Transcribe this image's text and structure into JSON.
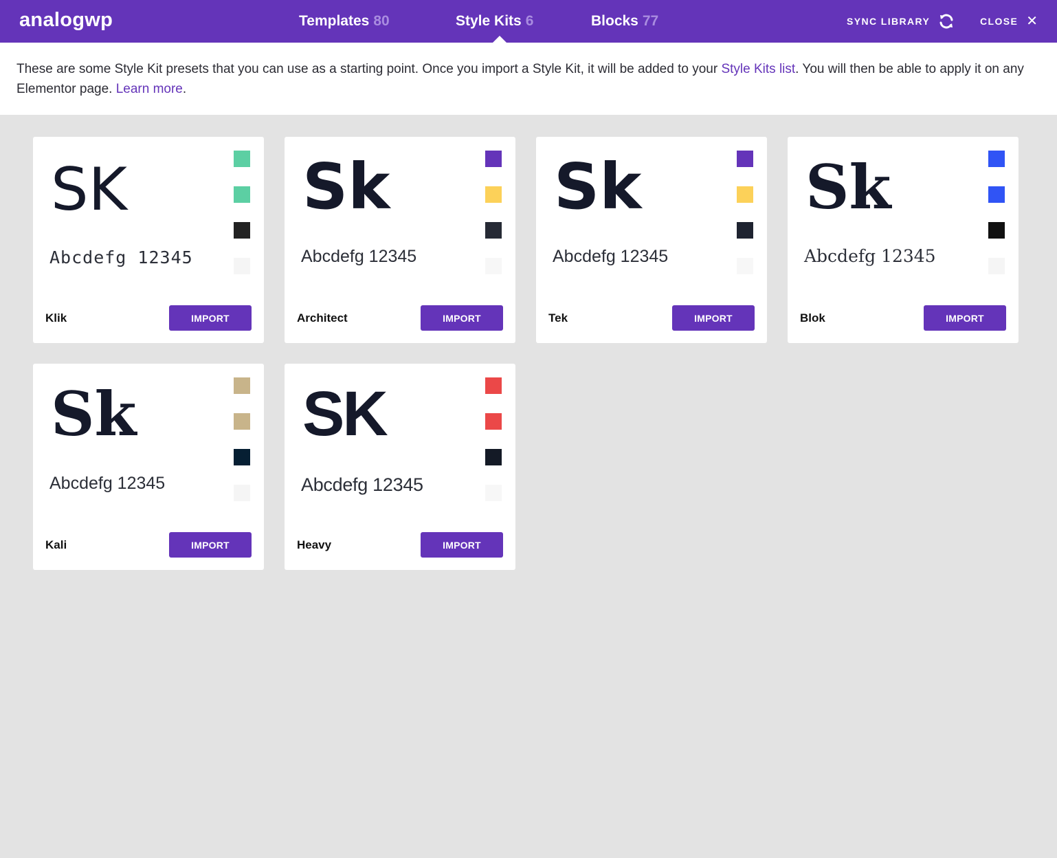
{
  "header": {
    "logo": "analogwp",
    "tabs": [
      {
        "label": "Templates",
        "count": "80"
      },
      {
        "label": "Style Kits",
        "count": "6"
      },
      {
        "label": "Blocks",
        "count": "77"
      }
    ],
    "sync_label": "SYNC LIBRARY",
    "close_label": "CLOSE",
    "close_glyph": "✕",
    "sync_icon": "refresh-icon"
  },
  "intro": {
    "text_before": "These are some Style Kit presets that you can use as a starting point. Once you import a Style Kit, it will be added to your ",
    "link_stylekits": "Style Kits list",
    "text_middle": ".  You will then be able to apply it on any Elementor page. ",
    "link_learn": "Learn more",
    "text_after": "."
  },
  "kits": [
    {
      "name": "Klik",
      "sample_big": "SK",
      "sample_small": "Abcdefg 12345",
      "import_label": "IMPORT",
      "colors": [
        "#5ccfa3",
        "#5ccfa3",
        "#222222",
        "#f5f5f5"
      ]
    },
    {
      "name": "Architect",
      "sample_big": "Sk",
      "sample_small": "Abcdefg 12345",
      "import_label": "IMPORT",
      "colors": [
        "#6434b9",
        "#fcd159",
        "#262a35",
        "#f7f7f7"
      ]
    },
    {
      "name": "Tek",
      "sample_big": "Sk",
      "sample_small": "Abcdefg 12345",
      "import_label": "IMPORT",
      "colors": [
        "#6434b9",
        "#fcd159",
        "#1e2330",
        "#f7f7f7"
      ]
    },
    {
      "name": "Blok",
      "sample_big": "Sk",
      "sample_small": "Abcdefg 12345",
      "import_label": "IMPORT",
      "colors": [
        "#3054f5",
        "#3054f5",
        "#111111",
        "#f5f5f5"
      ]
    },
    {
      "name": "Kali",
      "sample_big": "Sk",
      "sample_small": "Abcdefg 12345",
      "import_label": "IMPORT",
      "colors": [
        "#c8b48a",
        "#c8b48a",
        "#061f33",
        "#f5f5f5"
      ]
    },
    {
      "name": "Heavy",
      "sample_big": "SK",
      "sample_small": "Abcdefg 12345",
      "import_label": "IMPORT",
      "colors": [
        "#eb4848",
        "#eb4848",
        "#141a26",
        "#f7f7f7"
      ]
    }
  ]
}
